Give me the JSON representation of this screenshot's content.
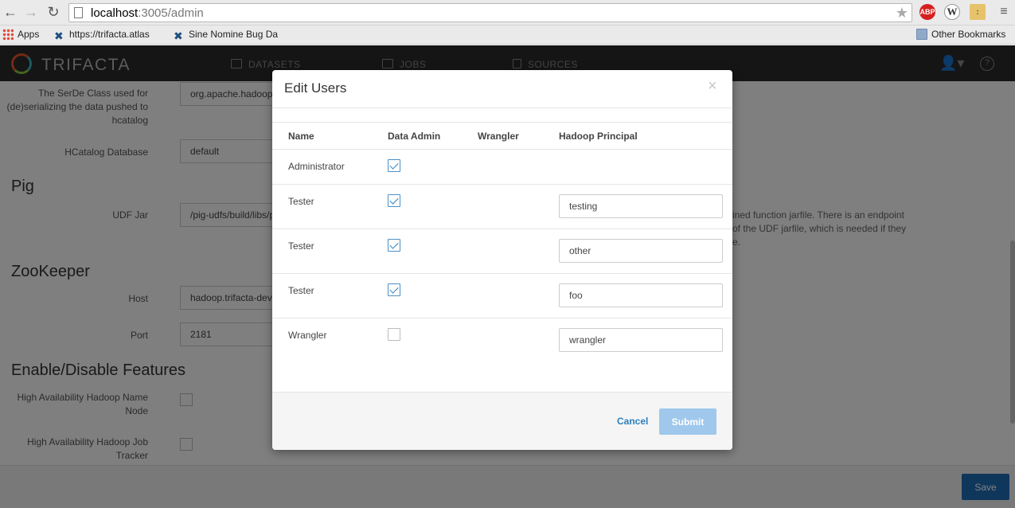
{
  "browser": {
    "url_host": "localhost",
    "url_rest": ":3005/admin",
    "back_icon": "back-arrow-icon",
    "forward_icon": "forward-arrow-icon",
    "reload_icon": "reload-icon",
    "extensions": [
      "ABP"
    ],
    "bookmarks": {
      "apps": "Apps",
      "item1": "https://trifacta.atlas",
      "item2": "Sine Nomine Bug Da",
      "other": "Other Bookmarks"
    }
  },
  "header": {
    "logo_text": "TRIFACTA",
    "nav": {
      "datasets": "DATASETS",
      "jobs": "JOBS",
      "sources": "SOURCES"
    }
  },
  "admin": {
    "serde_label": "The SerDe Class used for (de)serializing the data pushed to hcatalog",
    "serde_value": "org.apache.hadoop",
    "hcat_db_label": "HCatalog Database",
    "hcat_db_value": "default",
    "pig_title": "Pig",
    "udf_label": "UDF Jar",
    "udf_value": "/pig-udfs/build/libs/p",
    "udf_help_1": "ined function jarfile. There is an endpoint",
    "udf_help_2": "of the UDF jarfile, which is needed if they",
    "udf_help_3": "e.",
    "zk_title": "ZooKeeper",
    "host_label": "Host",
    "host_value": "hadoop.trifacta-dev",
    "port_label": "Port",
    "port_value": "2181",
    "features_title": "Enable/Disable Features",
    "ha_namenode_label": "High Availability Hadoop Name Node",
    "ha_jobtracker_label": "High Availability Hadoop Job Tracker",
    "save_label": "Save"
  },
  "modal": {
    "title": "Edit Users",
    "close_glyph": "×",
    "columns": {
      "name": "Name",
      "data_admin": "Data Admin",
      "wrangler": "Wrangler",
      "principal": "Hadoop Principal"
    },
    "rows": [
      {
        "name": "Administrator",
        "data_admin": true,
        "principal": null
      },
      {
        "name": "Tester",
        "data_admin": true,
        "principal": "testing"
      },
      {
        "name": "Tester",
        "data_admin": true,
        "principal": "other"
      },
      {
        "name": "Tester",
        "data_admin": true,
        "principal": "foo"
      },
      {
        "name": "Wrangler",
        "data_admin": false,
        "principal": "wrangler"
      }
    ],
    "cancel_label": "Cancel",
    "submit_label": "Submit"
  },
  "colors": {
    "accent": "#2c7fbf",
    "save_button": "#1e6fb8",
    "submit_disabled": "#9fc8ec",
    "header_bg": "#2b2b2b"
  }
}
